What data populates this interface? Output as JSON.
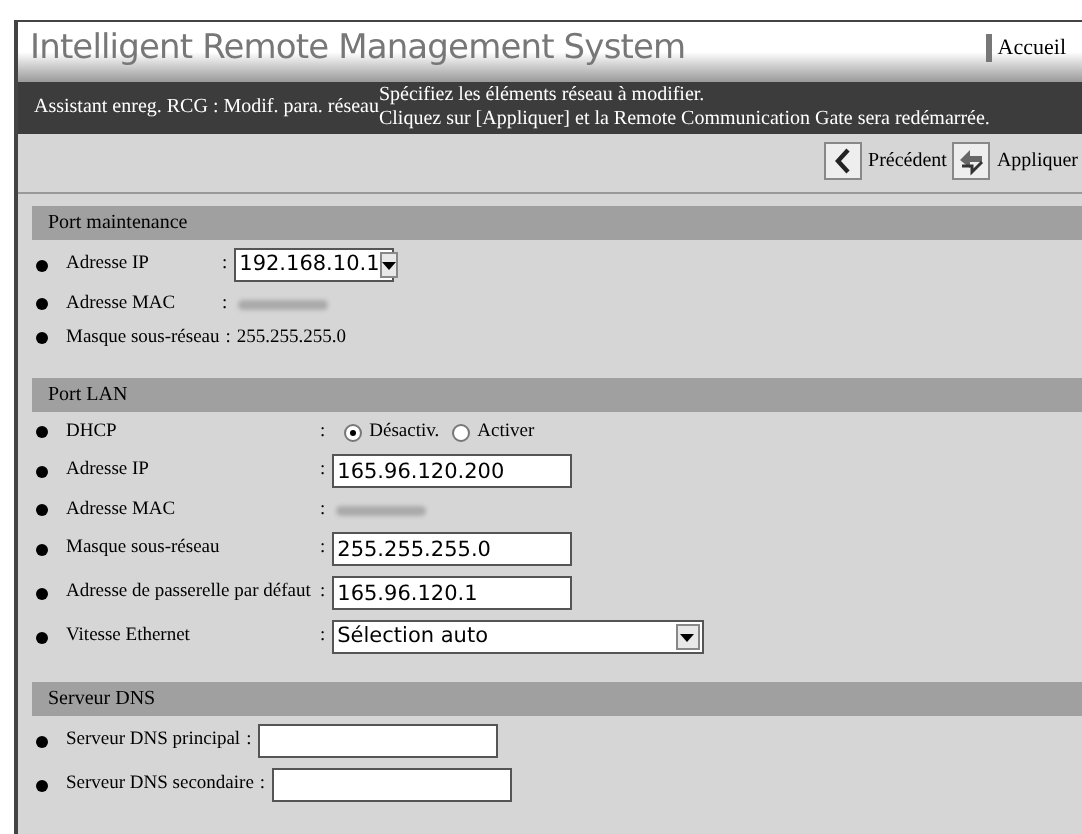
{
  "header": {
    "title": "Intelligent Remote Management System",
    "home_link": "Accueil"
  },
  "wizard_bar": {
    "step": "Assistant enreg. RCG : Modif. para. réseau",
    "instructions": [
      "Spécifiez les éléments réseau à modifier.",
      "Cliquez sur [Appliquer] et la Remote Communication Gate sera redémarrée."
    ]
  },
  "toolbar": {
    "buttons": [
      {
        "kind": "back",
        "label": "Précédent"
      },
      {
        "kind": "apply",
        "label": "Appliquer"
      }
    ]
  },
  "sections": [
    {
      "title": "Port maintenance",
      "rows": [
        {
          "kind": "select",
          "label": "Adresse IP",
          "separator": ":",
          "value": "192.168.10.1"
        },
        {
          "kind": "blurred",
          "label": "Adresse MAC",
          "separator": ":"
        },
        {
          "kind": "text",
          "label": "Masque sous-réseau",
          "separator": ":",
          "value": "255.255.255.0"
        }
      ]
    },
    {
      "title": "Port LAN",
      "rows": [
        {
          "kind": "radio",
          "label": "DHCP",
          "separator": ":",
          "options": [
            {
              "label": "Désactiv.",
              "selected": true
            },
            {
              "label": "Activer",
              "selected": false
            }
          ]
        },
        {
          "kind": "input",
          "label": "Adresse IP",
          "separator": ":",
          "value": "165.96.120.200"
        },
        {
          "kind": "blurred",
          "label": "Adresse MAC",
          "separator": ":"
        },
        {
          "kind": "input",
          "label": "Masque sous-réseau",
          "separator": ":",
          "value": "255.255.255.0"
        },
        {
          "kind": "input",
          "label": "Adresse de passerelle par défaut",
          "separator": ":",
          "value": "165.96.120.1"
        },
        {
          "kind": "select",
          "label": "Vitesse Ethernet",
          "separator": ":",
          "value": "Sélection auto"
        }
      ]
    },
    {
      "title": "Serveur DNS",
      "rows": [
        {
          "kind": "input",
          "label": "Serveur DNS principal",
          "separator": ":",
          "value": ""
        },
        {
          "kind": "input",
          "label": "Serveur DNS secondaire",
          "separator": ":",
          "value": ""
        }
      ]
    }
  ]
}
